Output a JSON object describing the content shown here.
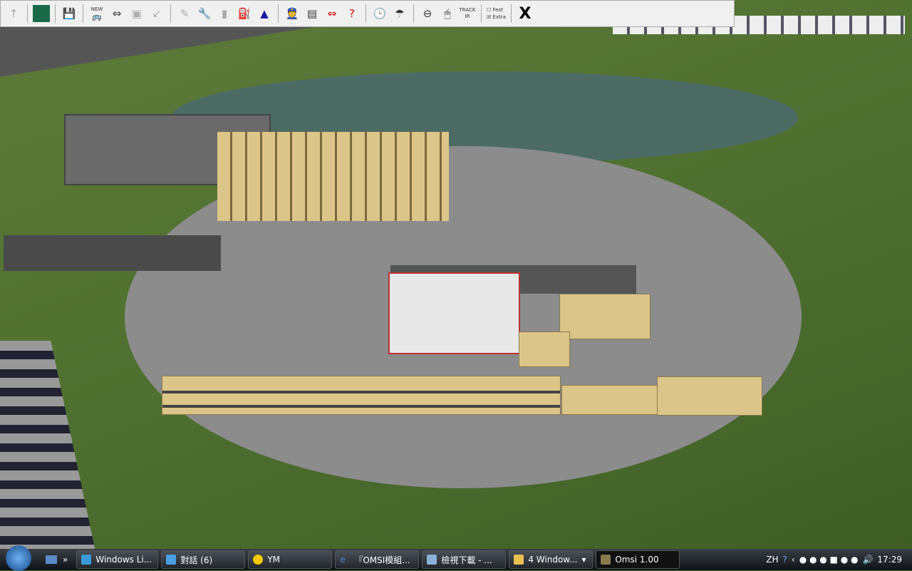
{
  "app": {
    "title": "Omsi 1.00"
  },
  "toolbar": {
    "buttons": [
      "up-arrow",
      "map",
      "save",
      "new-bus",
      "switch-bus",
      "delete-bus",
      "move",
      "repair",
      "wrench",
      "stop",
      "fuel",
      "bell",
      "driver",
      "timetable",
      "pc-swap",
      "help-arrow",
      "clock",
      "weather",
      "steering",
      "mouse",
      "trackir",
      "close"
    ],
    "track_ir_label": "TRACK IR",
    "new_label": "NEW",
    "checkbox1": {
      "label": "Fest",
      "checked": false
    },
    "checkbox2": {
      "label": "Extra",
      "checked": true
    },
    "close_label": "X"
  },
  "taskbar": {
    "tasks": [
      "Windows Li...",
      "對話 (6)",
      "YM",
      "『OMSI模組...",
      "檢視下載 - ...",
      "4 Window...",
      "Omsi 1.00"
    ],
    "language": "ZH",
    "clock": "17:29"
  }
}
